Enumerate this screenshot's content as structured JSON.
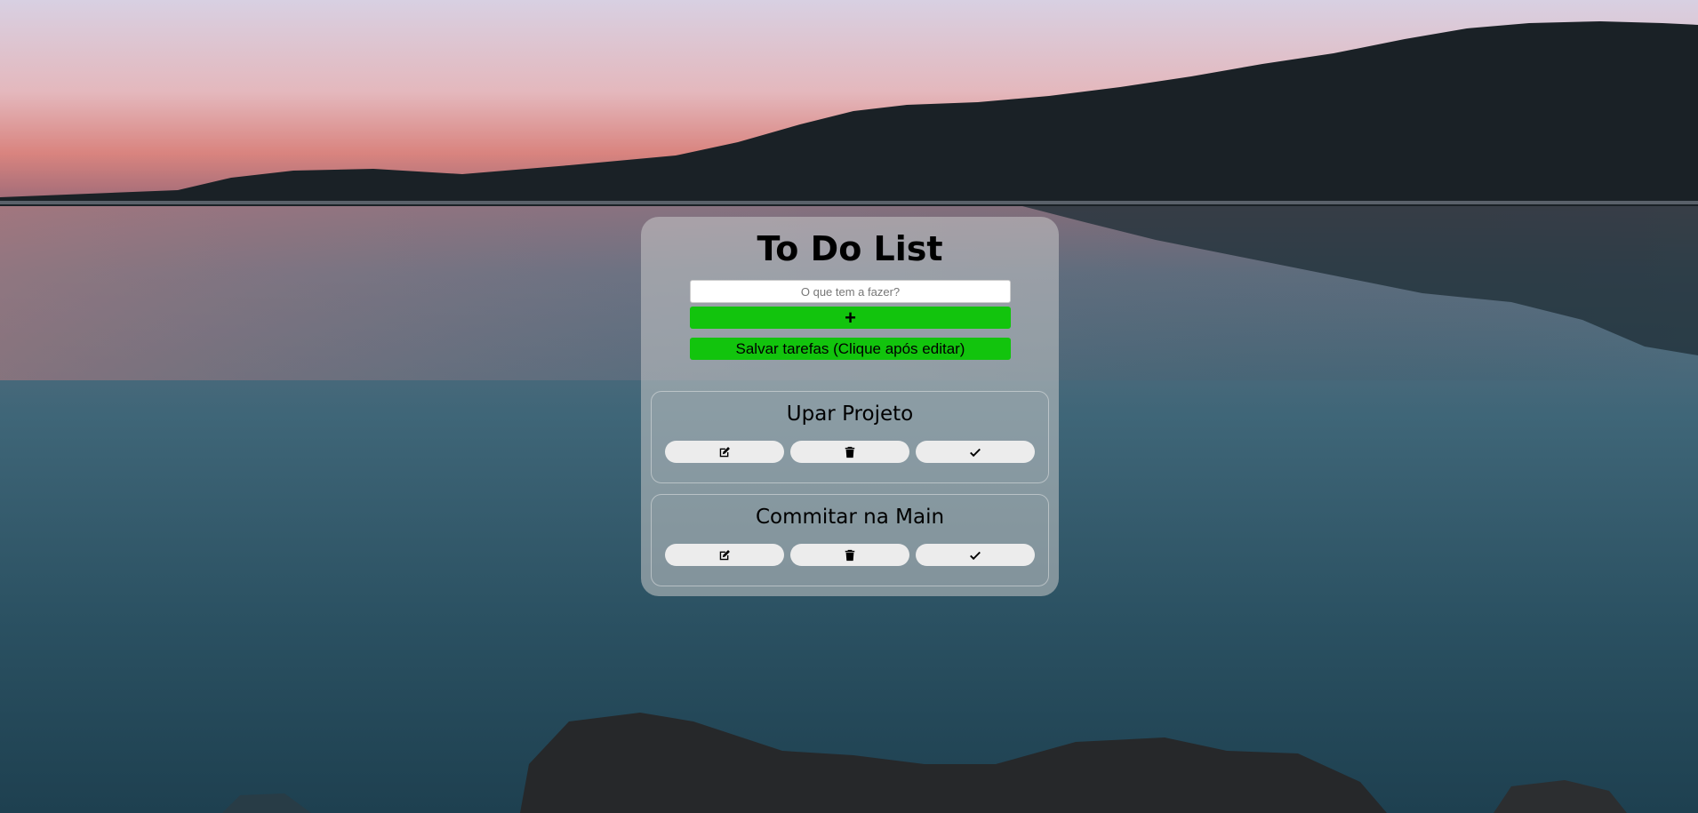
{
  "app": {
    "title": "To Do List"
  },
  "form": {
    "input_placeholder": "O que tem a fazer?",
    "input_value": "",
    "add_label": "+",
    "save_label": "Salvar tarefas (Clique após editar)",
    "accent_color": "#12c40d"
  },
  "tasks": [
    {
      "title": "Upar Projeto",
      "actions": [
        "edit-icon",
        "trash-icon",
        "check-icon"
      ]
    },
    {
      "title": "Commitar na Main",
      "actions": [
        "edit-icon",
        "trash-icon",
        "check-icon"
      ]
    }
  ]
}
